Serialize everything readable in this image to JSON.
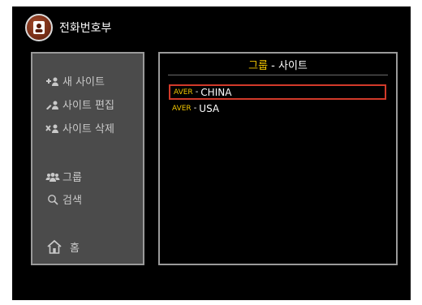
{
  "header": {
    "title": "전화번호부",
    "icon": "phonebook-contact-icon"
  },
  "menu": {
    "items": [
      {
        "name": "add-site",
        "label": "새 사이트",
        "icon": "add-user-icon"
      },
      {
        "name": "edit-site",
        "label": "사이트 편집",
        "icon": "edit-user-icon"
      },
      {
        "name": "delete-site",
        "label": "사이트 삭제",
        "icon": "delete-user-icon"
      },
      {
        "name": "group",
        "label": "그룹",
        "icon": "group-icon"
      },
      {
        "name": "search",
        "label": "검색",
        "icon": "search-icon"
      }
    ],
    "home": {
      "label": "홈",
      "icon": "home-icon"
    }
  },
  "list": {
    "title_group": "그룹",
    "title_sep": " - ",
    "title_site": "사이트",
    "rows": [
      {
        "group": "AVER",
        "sep": "-",
        "site": "CHINA",
        "selected": true
      },
      {
        "group": "AVER",
        "sep": "-",
        "site": "USA",
        "selected": false
      }
    ]
  },
  "colors": {
    "accent": "#f0c400",
    "selection": "#d23a2a",
    "panel": "#4b4b4b"
  }
}
